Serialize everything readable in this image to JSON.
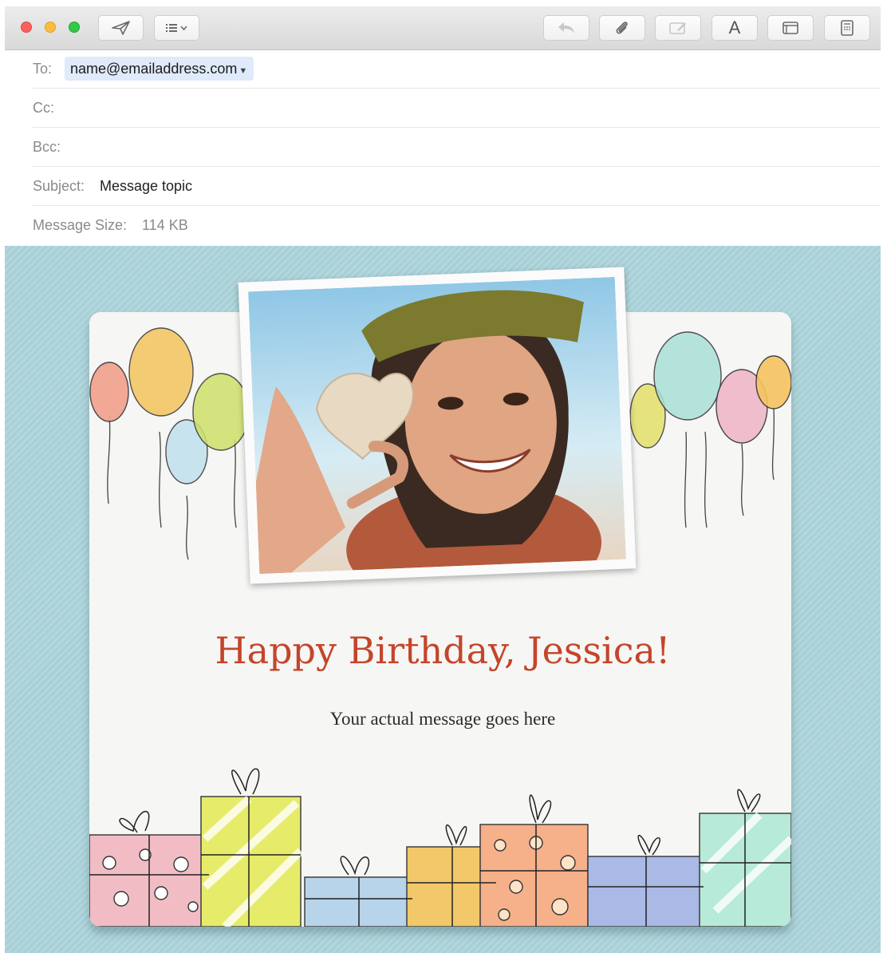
{
  "window": {
    "traffic_lights": {
      "close": "#fc605c",
      "minimize": "#fdbc40",
      "zoom": "#34c84a"
    }
  },
  "toolbar": {
    "left_buttons": [
      {
        "name": "send-button",
        "icon": "paper-plane-icon"
      },
      {
        "name": "header-fields-button",
        "icon": "list-chevron-icon"
      }
    ],
    "right_buttons": [
      {
        "name": "reply-button",
        "icon": "reply-arrow-icon",
        "enabled": false
      },
      {
        "name": "attach-button",
        "icon": "paperclip-icon",
        "enabled": true
      },
      {
        "name": "markup-button",
        "icon": "markup-icon",
        "enabled": false
      },
      {
        "name": "format-button",
        "icon": "font-icon",
        "label": "A",
        "enabled": true
      },
      {
        "name": "stationery-button",
        "icon": "stationery-window-icon",
        "enabled": true
      },
      {
        "name": "photo-browser-button",
        "icon": "photo-browser-icon",
        "enabled": true
      }
    ]
  },
  "headers": {
    "to_label": "To:",
    "to_value": "name@emailaddress.com",
    "cc_label": "Cc:",
    "bcc_label": "Bcc:",
    "subject_label": "Subject:",
    "subject_value": "Message topic",
    "message_size_label": "Message Size:",
    "message_size_value": "114 KB"
  },
  "stationery": {
    "greeting": "Happy Birthday, Jessica!",
    "message": "Your actual message goes here",
    "colors": {
      "background": "#a7cfd6",
      "card": "#f6f6f4",
      "greeting": "#c4452a"
    }
  }
}
